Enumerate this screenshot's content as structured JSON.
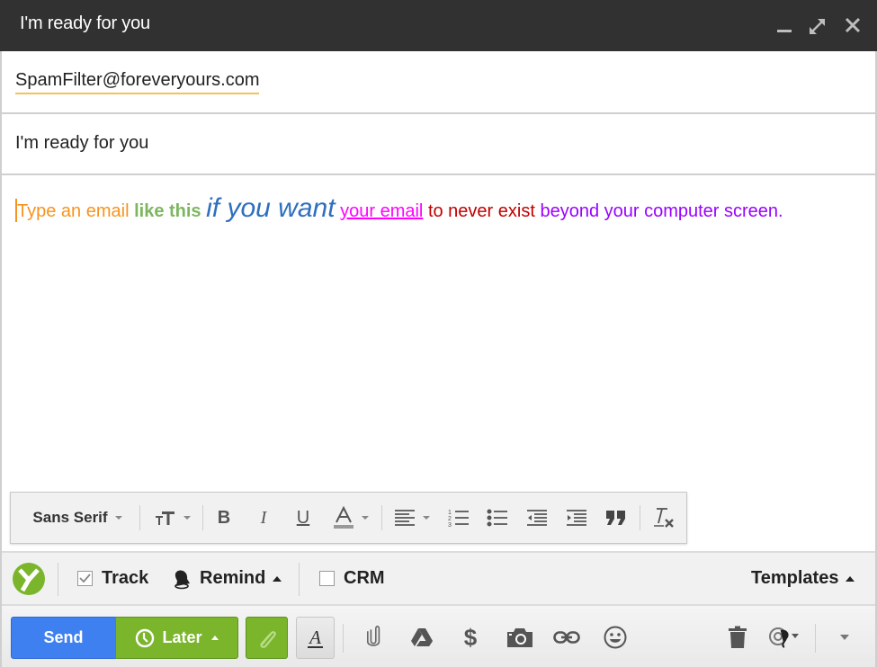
{
  "window": {
    "title": "I'm ready for you",
    "controls": [
      "minimize-icon",
      "expand-icon",
      "close-icon"
    ]
  },
  "compose": {
    "to": "SpamFilter@foreveryours.com",
    "subject": "I'm ready for you",
    "body_segments": [
      {
        "text": "Type an email ",
        "color": "#f7931e"
      },
      {
        "text": "like this",
        "color": "#7cb760",
        "style": "bold"
      },
      {
        "text": "if you want",
        "color": "#2e6fbe",
        "style": "italic large"
      },
      {
        "text": "your email",
        "color": "#ff00ff",
        "style": "underline"
      },
      {
        "text": "to never exist",
        "color": "#c00000"
      },
      {
        "text": "beyond your computer screen.",
        "color": "#9900ff"
      }
    ]
  },
  "format_toolbar": {
    "font": "Sans Serif",
    "items": [
      "font-size",
      "bold",
      "italic",
      "underline",
      "text-color",
      "align",
      "numbered-list",
      "bulleted-list",
      "indent-less",
      "indent-more",
      "quote",
      "remove-formatting"
    ]
  },
  "extension_bar": {
    "track_label": "Track",
    "track_checked": true,
    "remind_label": "Remind",
    "crm_label": "CRM",
    "crm_checked": false,
    "templates_label": "Templates"
  },
  "action_bar": {
    "send_label": "Send",
    "later_label": "Later",
    "icons": [
      "attach-icon",
      "drive-icon",
      "dollar-icon",
      "camera-icon",
      "link-icon",
      "emoji-icon",
      "trash-icon",
      "signature-icon",
      "more-options-icon"
    ]
  },
  "colors": {
    "titlebar": "#313131",
    "send_blue": "#3f80f0",
    "later_green": "#7ab52c",
    "to_underline": "#f5c158"
  }
}
